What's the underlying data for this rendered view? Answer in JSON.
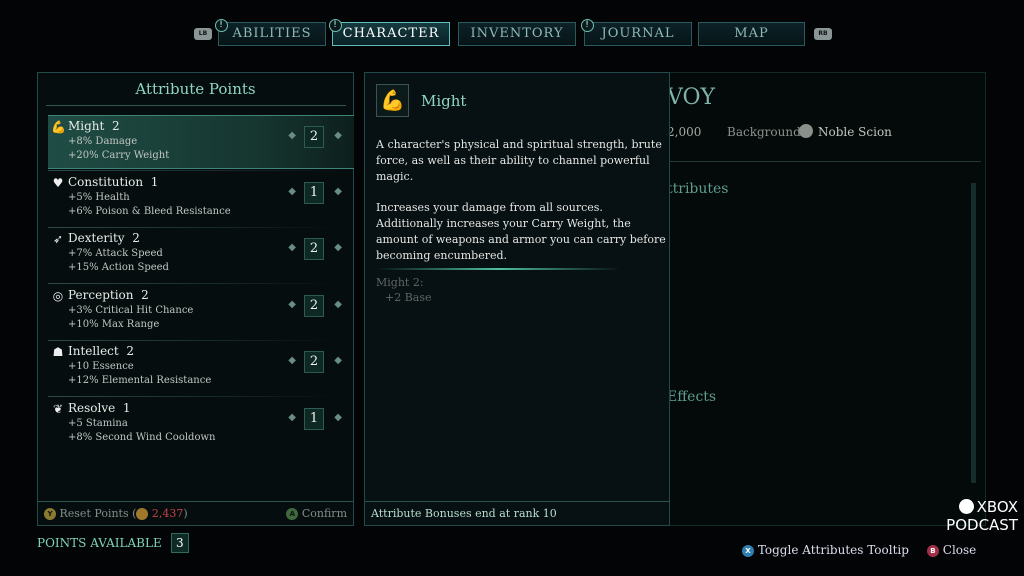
{
  "nav": {
    "lb": "LB",
    "rb": "RB",
    "tabs": [
      {
        "label": "ABILITIES",
        "alert": "!"
      },
      {
        "label": "CHARACTER",
        "alert": "!",
        "active": true
      },
      {
        "label": "INVENTORY"
      },
      {
        "label": "JOURNAL",
        "alert": "!"
      },
      {
        "label": "MAP"
      }
    ]
  },
  "attributes": {
    "title": "Attribute Points",
    "items": [
      {
        "name": "Might",
        "rank": "2",
        "bonuses": [
          "+8% Damage",
          "+20% Carry Weight"
        ],
        "value": "2",
        "icon": "muscle-arm-icon",
        "selected": true
      },
      {
        "name": "Constitution",
        "rank": "1",
        "bonuses": [
          "+5% Health",
          "+6% Poison & Bleed Resistance"
        ],
        "value": "1",
        "icon": "heart-body-icon"
      },
      {
        "name": "Dexterity",
        "rank": "2",
        "bonuses": [
          "+7% Attack Speed",
          "+15% Action Speed"
        ],
        "value": "2",
        "icon": "running-figure-icon"
      },
      {
        "name": "Perception",
        "rank": "2",
        "bonuses": [
          "+3% Critical Hit Chance",
          "+10% Max Range"
        ],
        "value": "2",
        "icon": "eye-swirl-icon"
      },
      {
        "name": "Intellect",
        "rank": "2",
        "bonuses": [
          "+10 Essence",
          "+12% Elemental Resistance"
        ],
        "value": "2",
        "icon": "head-brain-icon"
      },
      {
        "name": "Resolve",
        "rank": "1",
        "bonuses": [
          "+5 Stamina",
          "+8% Second Wind Cooldown"
        ],
        "value": "1",
        "icon": "heart-hand-icon"
      }
    ],
    "reset_button": "Y",
    "reset_label": "Reset Points",
    "reset_cost": "2,437",
    "confirm_button": "A",
    "confirm_label": "Confirm"
  },
  "points_available": {
    "label": "POINTS AVAILABLE",
    "value": "3"
  },
  "tooltip": {
    "title": "Might",
    "description": "A character's physical and spiritual strength, brute force, as well as their ability to channel powerful magic.",
    "details": "Increases your damage from all sources. Additionally increases your Carry Weight, the amount of weapons and armor you can carry before becoming encumbered.",
    "breakdown_title": "Might 2:",
    "breakdown_line": "+2 Base",
    "footer": "Attribute Bonuses end at rank 10"
  },
  "character": {
    "name_partial": "VOY",
    "stat_partial": "2,000",
    "background_label": "Background:",
    "background_value": "Noble Scion",
    "attributes_partial": "ttributes",
    "effects_partial": "Effects"
  },
  "watermark": {
    "line1": "XBOX",
    "line2": "PODCAST"
  },
  "hints": [
    {
      "button": "X",
      "label": "Toggle Attributes Tooltip",
      "color": "#2f7fb0"
    },
    {
      "button": "B",
      "label": "Close",
      "color": "#a03048"
    }
  ],
  "colors": {
    "accent": "#5fbdb9",
    "title": "#8fd6c4",
    "cost": "#c8404a"
  }
}
